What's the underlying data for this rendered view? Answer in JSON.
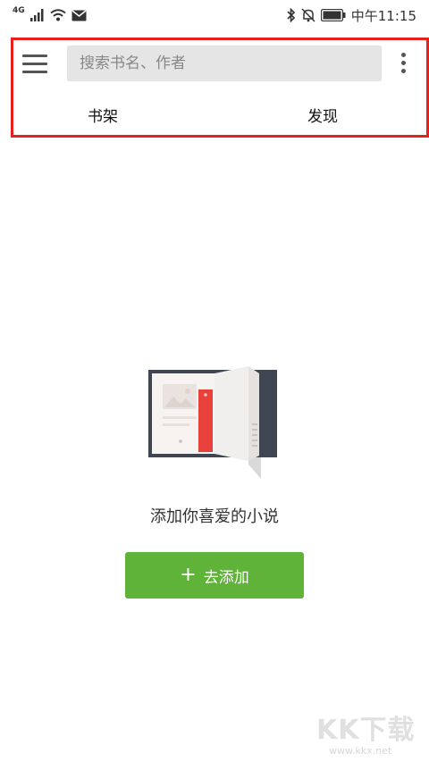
{
  "status_bar": {
    "network_label": "4G",
    "time": "中午11:15"
  },
  "header": {
    "menu_icon": "hamburger-menu-icon",
    "search_placeholder": "搜索书名、作者",
    "more_icon": "more-vert-icon",
    "tabs": [
      {
        "label": "书架"
      },
      {
        "label": "发现"
      }
    ],
    "highlight_color": "#e8201d"
  },
  "empty_state": {
    "illustration": "open-book-icon",
    "message": "添加你喜爱的小说",
    "add_button_icon": "+",
    "add_button_label": "去添加",
    "button_color": "#5fb338"
  },
  "watermark": {
    "logo": "KK下载",
    "url": "www.kkx.net"
  }
}
